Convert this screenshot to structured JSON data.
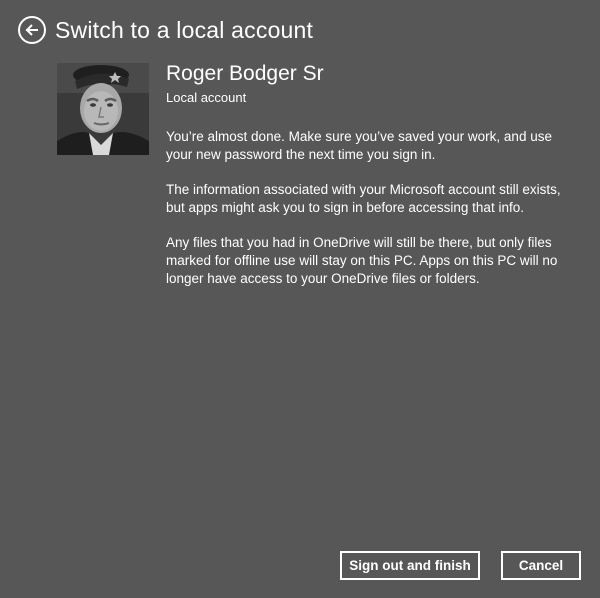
{
  "header": {
    "title": "Switch to a local account",
    "back_icon": "back-arrow-circle-icon"
  },
  "user": {
    "name": "Roger Bodger Sr",
    "account_type": "Local account"
  },
  "info": {
    "paragraph_1": [
      "You’re almost done. Make sure you’ve saved your work, and use",
      "your new password the next time you sign in."
    ],
    "paragraph_2": [
      "The information associated with your Microsoft account still exists,",
      "but apps might ask you to sign in before accessing that info."
    ],
    "paragraph_3": [
      "Any files that you had in OneDrive will still be there, but only files",
      "marked for offline use will stay on this PC. Apps on this PC will no",
      "longer have access to your OneDrive files or folders."
    ]
  },
  "actions": {
    "finish_label": "Sign out and finish",
    "cancel_label": "Cancel"
  },
  "colors": {
    "background": "#575757",
    "foreground": "#ffffff"
  }
}
